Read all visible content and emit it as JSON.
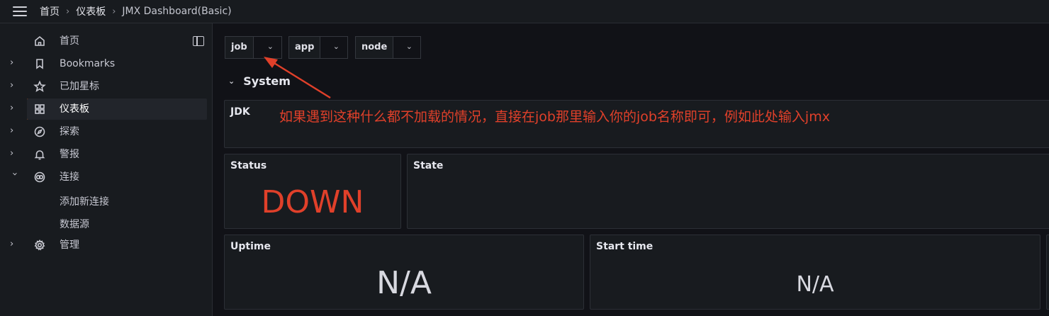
{
  "topbar": {
    "breadcrumbs": [
      "首页",
      "仪表板",
      "JMX Dashboard(Basic)"
    ]
  },
  "sidebar": {
    "items": [
      {
        "label": "首页",
        "icon": "home-icon"
      },
      {
        "label": "Bookmarks",
        "icon": "bookmark-icon"
      },
      {
        "label": "已加星标",
        "icon": "star-icon"
      },
      {
        "label": "仪表板",
        "icon": "dashboards-grid-icon"
      },
      {
        "label": "探索",
        "icon": "compass-icon"
      },
      {
        "label": "警报",
        "icon": "bell-icon"
      },
      {
        "label": "连接",
        "icon": "connections-icon"
      },
      {
        "label": "管理",
        "icon": "gear-icon"
      }
    ],
    "sub_items": [
      "添加新连接",
      "数据源"
    ]
  },
  "variables": [
    {
      "name": "job"
    },
    {
      "name": "app"
    },
    {
      "name": "node"
    }
  ],
  "row": {
    "title": "System"
  },
  "panels": {
    "jdk": {
      "title": "JDK"
    },
    "status": {
      "title": "Status",
      "value": "DOWN"
    },
    "state": {
      "title": "State"
    },
    "uptime": {
      "title": "Uptime",
      "value": "N/A"
    },
    "start_time": {
      "title": "Start time",
      "value": "N/A"
    }
  },
  "annotation": {
    "text": "如果遇到这种什么都不加载的情况，直接在job那里输入你的job名称即可，例如此处输入jmx"
  },
  "colors": {
    "accent": "#f26b21",
    "status_down": "#e0402a",
    "annotation": "#e0402a",
    "background": "#111217",
    "panel": "#181b1f"
  }
}
